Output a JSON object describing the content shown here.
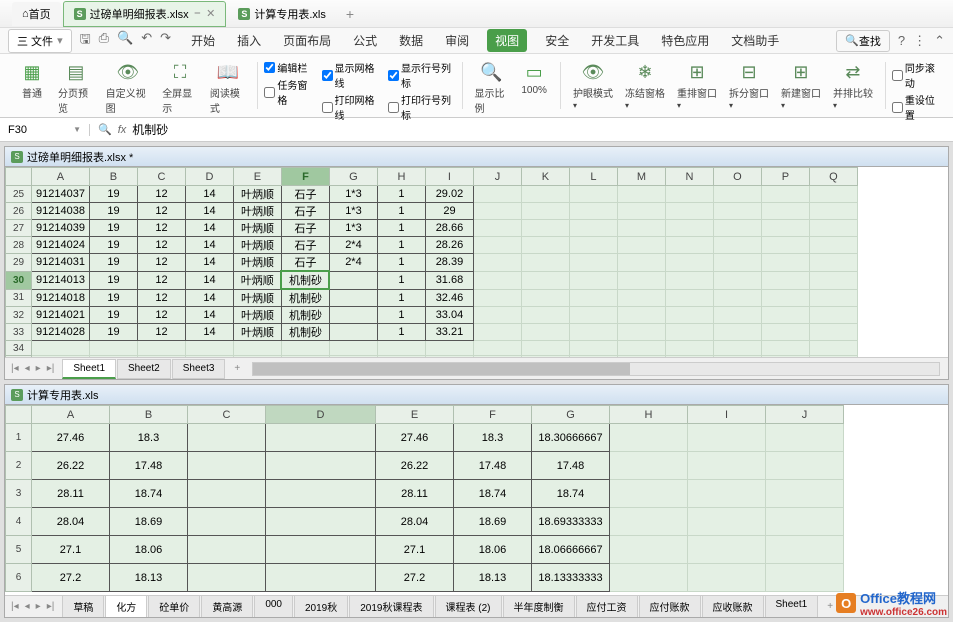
{
  "titlebar": {
    "home": "首页",
    "tabs": [
      {
        "label": "过磅单明细报表.xlsx",
        "active": true
      },
      {
        "label": "计算专用表.xls",
        "active": false
      }
    ]
  },
  "menubar": {
    "file": "三 文件",
    "tabs": [
      "开始",
      "插入",
      "页面布局",
      "公式",
      "数据",
      "审阅",
      "视图",
      "安全",
      "开发工具",
      "特色应用",
      "文档助手"
    ],
    "active_idx": 6,
    "search": "查找"
  },
  "ribbon": {
    "g1": [
      "普通",
      "分页预览",
      "自定义视图",
      "全屏显示",
      "阅读模式"
    ],
    "checks1": [
      {
        "l": "编辑栏",
        "c": true
      },
      {
        "l": "任务窗格",
        "c": false
      }
    ],
    "checks2": [
      {
        "l": "显示网格线",
        "c": true
      },
      {
        "l": "打印网格线",
        "c": false
      }
    ],
    "checks3": [
      {
        "l": "显示行号列标",
        "c": true
      },
      {
        "l": "打印行号列标",
        "c": false
      }
    ],
    "zoom": "显示比例",
    "pct": "100%",
    "g2": [
      "护眼模式",
      "冻结窗格",
      "重排窗口",
      "拆分窗口",
      "新建窗口",
      "并排比较"
    ],
    "side": [
      {
        "l": "同步滚动",
        "c": false
      },
      {
        "l": "重设位置",
        "c": false
      }
    ]
  },
  "formula": {
    "namebox": "F30",
    "fx": "fx",
    "value": "机制砂"
  },
  "panel1": {
    "title": "过磅单明细报表.xlsx *",
    "cols": [
      "A",
      "B",
      "C",
      "D",
      "E",
      "F",
      "G",
      "H",
      "I",
      "J",
      "K",
      "L",
      "M",
      "N",
      "O",
      "P",
      "Q"
    ],
    "rows_start": 25,
    "rows": [
      [
        "91214037",
        "19",
        "12",
        "14",
        "叶炳顺",
        "石子",
        "1*3",
        "1",
        "29.02"
      ],
      [
        "91214038",
        "19",
        "12",
        "14",
        "叶炳顺",
        "石子",
        "1*3",
        "1",
        "29"
      ],
      [
        "91214039",
        "19",
        "12",
        "14",
        "叶炳顺",
        "石子",
        "1*3",
        "1",
        "28.66"
      ],
      [
        "91214024",
        "19",
        "12",
        "14",
        "叶炳顺",
        "石子",
        "2*4",
        "1",
        "28.26"
      ],
      [
        "91214031",
        "19",
        "12",
        "14",
        "叶炳顺",
        "石子",
        "2*4",
        "1",
        "28.39"
      ],
      [
        "91214013",
        "19",
        "12",
        "14",
        "叶炳顺",
        "机制砂",
        "",
        "1",
        "31.68"
      ],
      [
        "91214018",
        "19",
        "12",
        "14",
        "叶炳顺",
        "机制砂",
        "",
        "1",
        "32.46"
      ],
      [
        "91214021",
        "19",
        "12",
        "14",
        "叶炳顺",
        "机制砂",
        "",
        "1",
        "33.04"
      ],
      [
        "91214028",
        "19",
        "12",
        "14",
        "叶炳顺",
        "机制砂",
        "",
        "1",
        "33.21"
      ]
    ],
    "selected_row": 30,
    "selected_col": "F",
    "sheets": [
      "Sheet1",
      "Sheet2",
      "Sheet3"
    ],
    "active_sheet": 0
  },
  "panel2": {
    "title": "计算专用表.xls",
    "cols": [
      "A",
      "B",
      "C",
      "D",
      "E",
      "F",
      "G",
      "H",
      "I",
      "J"
    ],
    "rows": [
      [
        "27.46",
        "18.3",
        "",
        "",
        "27.46",
        "18.3",
        "18.30666667",
        "",
        ""
      ],
      [
        "26.22",
        "17.48",
        "",
        "",
        "26.22",
        "17.48",
        "17.48",
        "",
        ""
      ],
      [
        "28.11",
        "18.74",
        "",
        "",
        "28.11",
        "18.74",
        "18.74",
        "",
        ""
      ],
      [
        "28.04",
        "18.69",
        "",
        "",
        "28.04",
        "18.69",
        "18.69333333",
        "",
        ""
      ],
      [
        "27.1",
        "18.06",
        "",
        "",
        "27.1",
        "18.06",
        "18.06666667",
        "",
        ""
      ],
      [
        "27.2",
        "18.13",
        "",
        "",
        "27.2",
        "18.13",
        "18.13333333",
        "",
        ""
      ]
    ],
    "sheets": [
      "草稿",
      "化方",
      "砼单价",
      "黄高源",
      "000",
      "2019秋",
      "2019秋课程表",
      "课程表 (2)",
      "半年度制衡",
      "应付工资",
      "应付账款",
      "应收账款",
      "Sheet1"
    ],
    "active_sheet": 1
  },
  "watermark": {
    "l1": "Office教程网",
    "l2": "www.office26.com"
  }
}
